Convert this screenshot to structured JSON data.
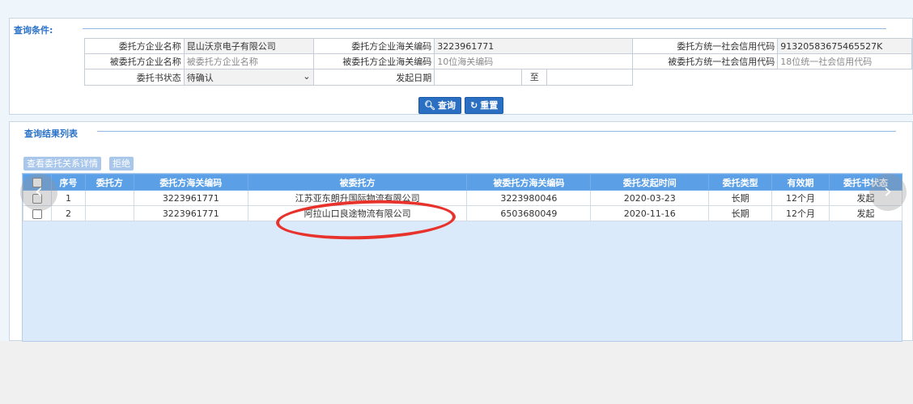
{
  "query": {
    "legend": "查询条件:",
    "rows": [
      {
        "label1": "委托方企业名称",
        "value1": "昆山沃京电子有限公司",
        "label2": "委托方企业海关编码",
        "value2": "3223961771",
        "label3": "委托方统一社会信用代码",
        "value3": "91320583675465527K"
      },
      {
        "label1": "被委托方企业名称",
        "placeholder1": "被委托方企业名称",
        "label2": "被委托方企业海关编码",
        "placeholder2": "10位海关编码",
        "label3": "被委托方统一社会信用代码",
        "placeholder3": "18位统一社会信用代码"
      }
    ],
    "status_label": "委托书状态",
    "status_value": "待确认",
    "date_label": "发起日期",
    "date_to": "至",
    "search_button": "查询",
    "reset_button": "重置"
  },
  "result": {
    "legend": "查询结果列表",
    "toolbar": {
      "detail_button": "查看委托关系详情",
      "reject_button": "拒绝"
    },
    "columns": [
      "序号",
      "委托方",
      "委托方海关编码",
      "被委托方",
      "被委托方海关编码",
      "委托发起时间",
      "委托类型",
      "有效期",
      "委托书状态"
    ],
    "rows": [
      {
        "no": "1",
        "client": "",
        "client_code": "3223961771",
        "agent": "江苏亚东朗升国际物流有限公司",
        "agent_code": "3223980046",
        "time": "2020-03-23",
        "type": "长期",
        "validity": "12个月",
        "status": "发起"
      },
      {
        "no": "2",
        "client": "",
        "client_code": "3223961771",
        "agent": "阿拉山口良途物流有限公司",
        "agent_code": "6503680049",
        "time": "2020-11-16",
        "type": "长期",
        "validity": "12个月",
        "status": "发起"
      }
    ]
  },
  "icons": {
    "search": "search-icon",
    "reset": "refresh-icon",
    "prev": "chevron-left-icon",
    "next": "chevron-right-icon"
  },
  "colors": {
    "accent": "#2a6fc2",
    "header": "#5b9fe6",
    "annotation": "#e8322c"
  }
}
